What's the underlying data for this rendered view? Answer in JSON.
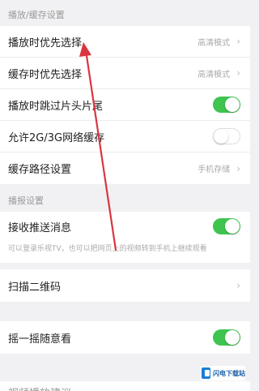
{
  "sections": {
    "playback_cache": {
      "header": "播放/缓存设置",
      "rows": [
        {
          "label": "播放时优先选择",
          "value": "高清模式",
          "control": "chevron"
        },
        {
          "label": "缓存时优先选择",
          "value": "高清模式",
          "control": "chevron"
        },
        {
          "label": "播放时跳过片头片尾",
          "control": "toggle",
          "on": true
        },
        {
          "label": "允许2G/3G网络缓存",
          "control": "toggle",
          "on": false
        },
        {
          "label": "缓存路径设置",
          "value": "手机存储",
          "control": "chevron"
        }
      ]
    },
    "message": {
      "header": "播报设置",
      "push_label": "接收推送消息",
      "push_on": true,
      "desc": "可以登录乐视TV，也可以把网页上的视频转到手机上继续观看",
      "scan_label": "扫描二维码"
    },
    "shake": {
      "label": "摇一摇随意看",
      "on": true
    }
  },
  "bottom_peek": "视频播放建议",
  "watermark": {
    "text": "闪电下载站"
  },
  "colors": {
    "toggle_on": "#3fc44f",
    "annotation_arrow": "#d9363e"
  },
  "icons": {
    "chevron": "›"
  }
}
